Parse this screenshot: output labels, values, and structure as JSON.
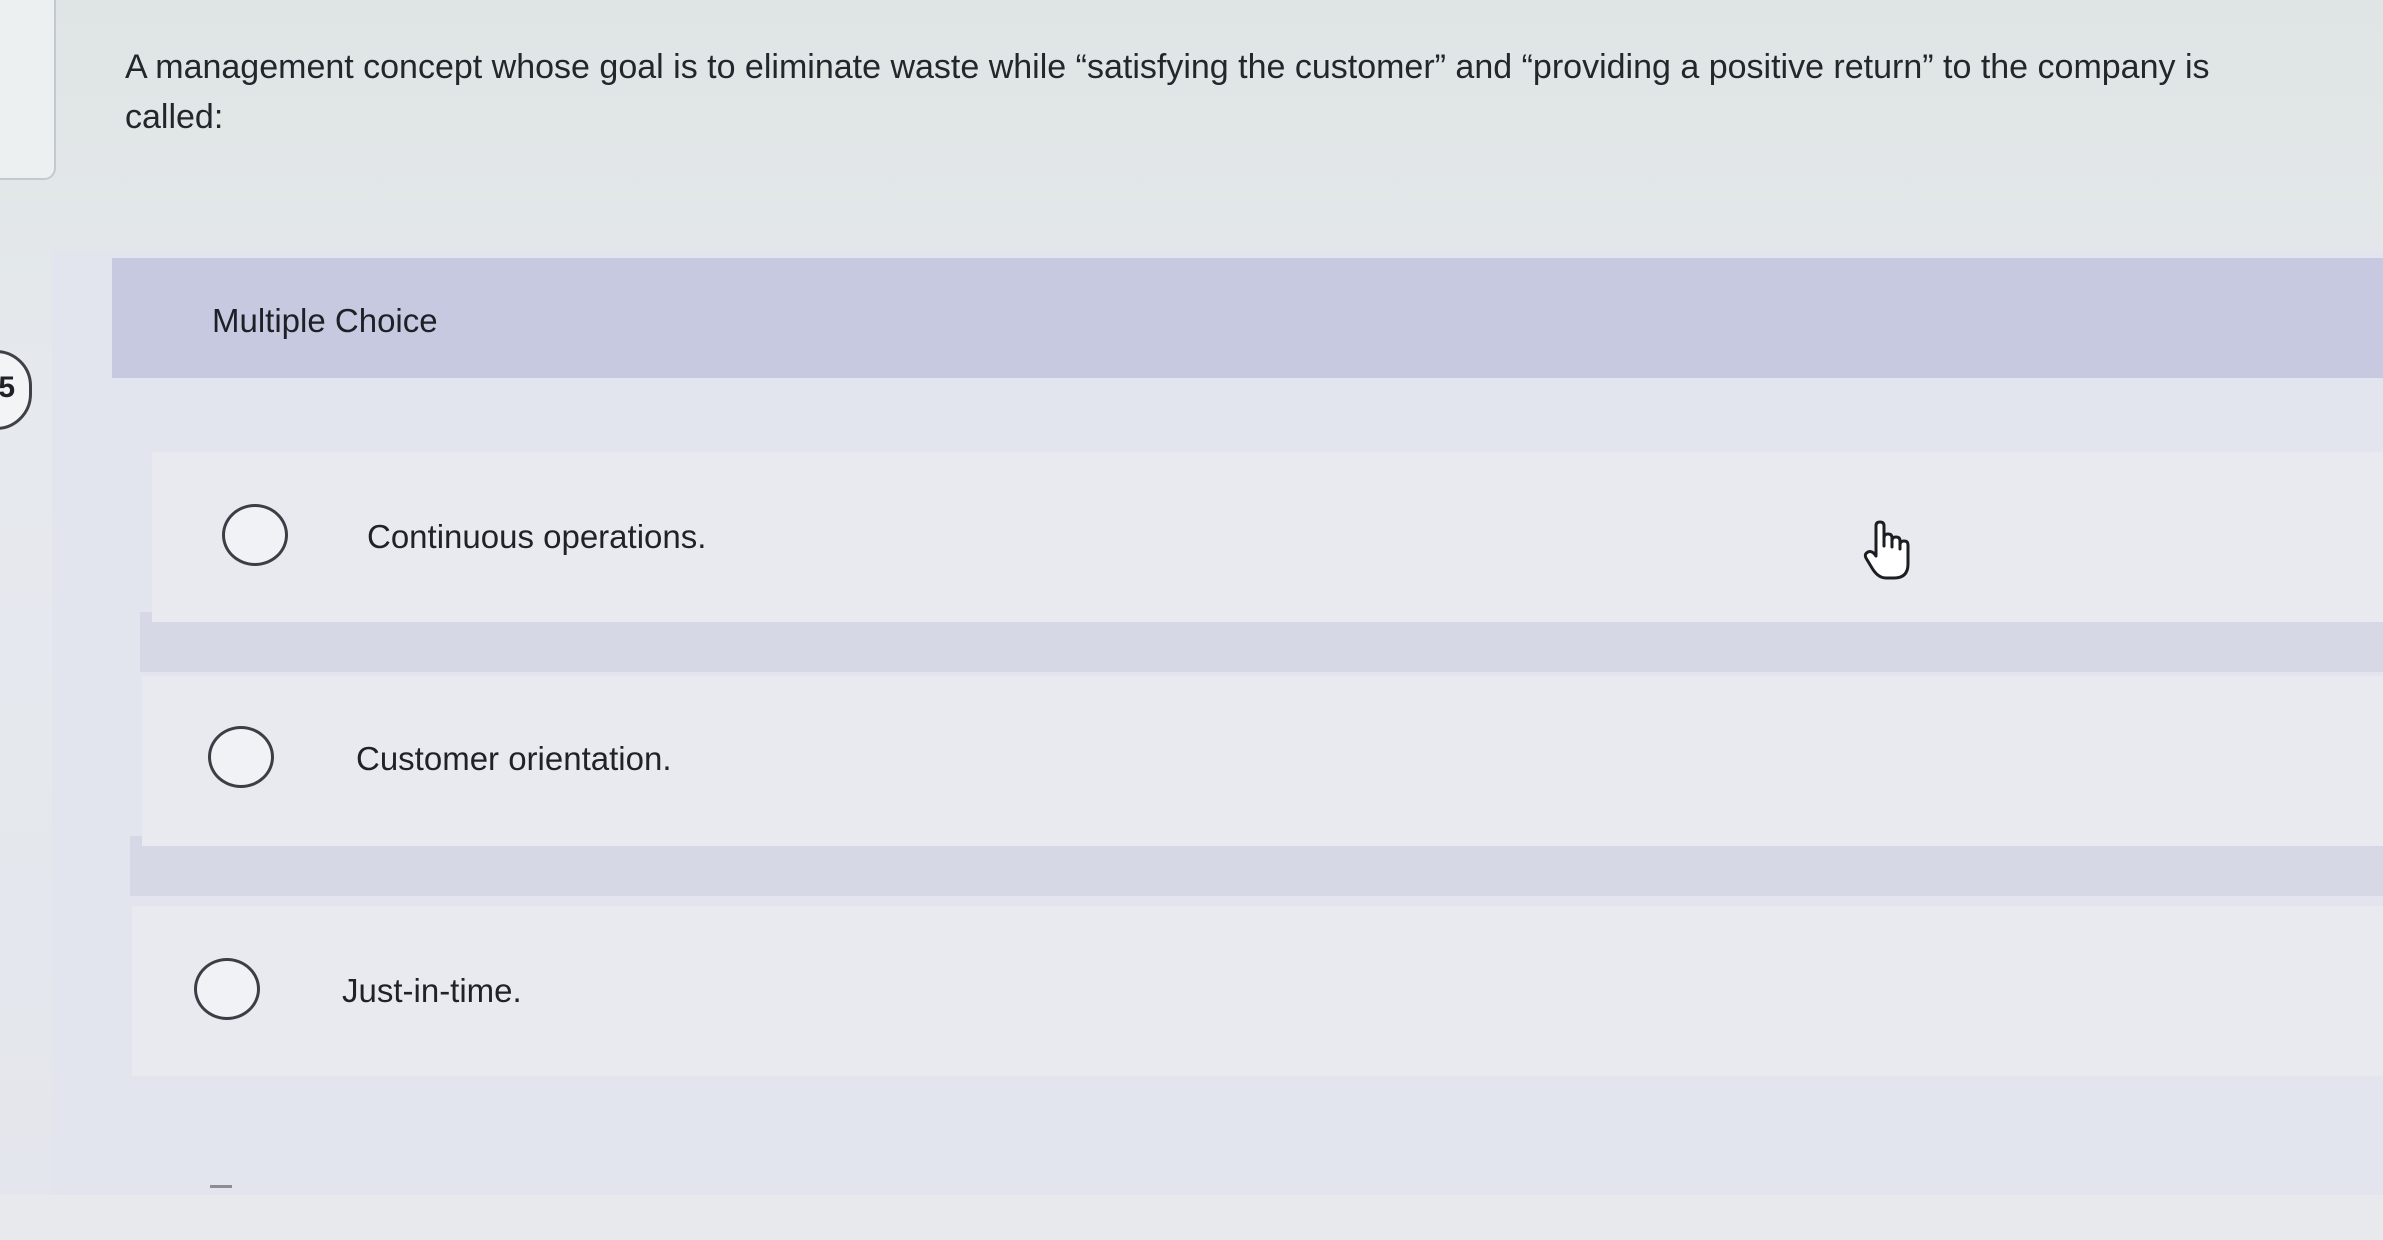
{
  "question": {
    "number_fragment": "5",
    "text": "A management concept whose goal is to eliminate waste while “satisfying the customer” and “providing a positive return” to the company is called:"
  },
  "multiple_choice": {
    "header_label": "Multiple Choice",
    "options": [
      {
        "label": "Continuous operations.",
        "selected": false
      },
      {
        "label": "Customer orientation.",
        "selected": false
      },
      {
        "label": "Just-in-time.",
        "selected": false
      }
    ]
  },
  "cursor": {
    "icon": "hand-pointer-icon"
  }
}
